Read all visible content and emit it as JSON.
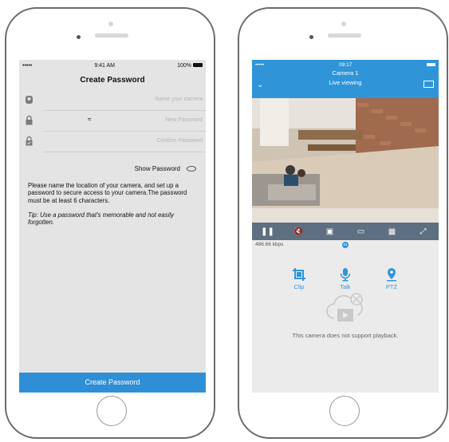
{
  "left_phone": {
    "status": {
      "carrier": "•••••",
      "time": "9:41 AM",
      "battery": "100%"
    },
    "title": "Create Password",
    "fields": [
      {
        "icon": "camera-icon",
        "placeholder": "Name your camera"
      },
      {
        "icon": "lock-icon",
        "placeholder": "New Password"
      },
      {
        "icon": "lock-check-icon",
        "placeholder": "Confirm Password"
      }
    ],
    "show_password": "Show Password",
    "description": "Please name the location of your camera, and set up a password to secure access to your camera.The password must be at least 6 characters.",
    "tip": "Tip: Use a password that's memorable and not easily forgotten.",
    "button": "Create Password"
  },
  "right_phone": {
    "status": {
      "carrier": "•••••",
      "time": "09:17"
    },
    "camera_name": "Camera 1",
    "mode": "Live viewing",
    "bitrate": "486.66 kbps",
    "page_indicator": "01",
    "actions": [
      {
        "label": "Clip",
        "icon": "crop-icon"
      },
      {
        "label": "Talk",
        "icon": "microphone-icon"
      },
      {
        "label": "PTZ",
        "icon": "location-pin-icon"
      }
    ],
    "no_playback": "This camera does not support playback.",
    "accent": "#2f95d8"
  }
}
